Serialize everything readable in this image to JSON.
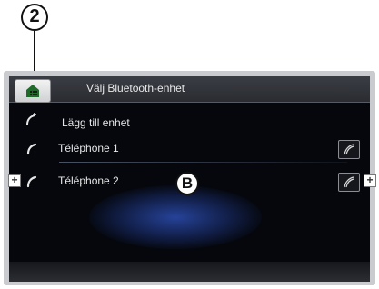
{
  "callouts": {
    "top": "2",
    "center": "B"
  },
  "header": {
    "title": "Välj Bluetooth-enhet",
    "home_icon": "home-grid-icon"
  },
  "list": [
    {
      "label": "Lägg till enhet",
      "icon": "add-phone-icon"
    },
    {
      "label": "Téléphone 1",
      "icon": "phone-icon"
    },
    {
      "label": "Téléphone 2",
      "icon": "phone-icon"
    }
  ],
  "side_markers": {
    "plus": "+"
  },
  "colors": {
    "screen_bg": "#05070c",
    "glow": "#2846a0",
    "text": "#e6e6e6"
  }
}
